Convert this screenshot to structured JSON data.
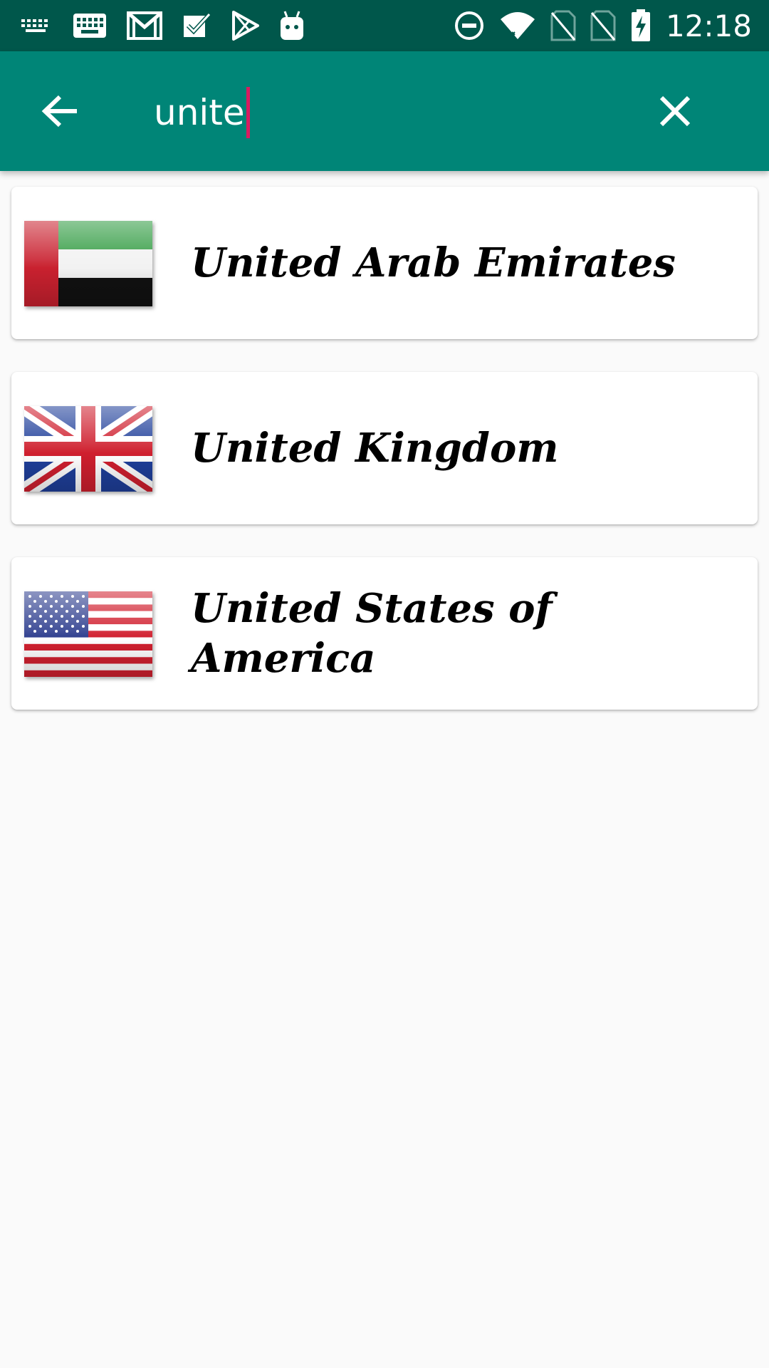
{
  "status_bar": {
    "time": "12:18",
    "left_icons": [
      "keyboard-icon",
      "keyboard-icon",
      "gmail-icon",
      "tasks-icon",
      "play-store-icon",
      "android-icon"
    ],
    "right_icons": [
      "do-not-disturb-icon",
      "wifi-icon",
      "no-sim-icon",
      "no-sim-icon",
      "battery-charging-icon"
    ]
  },
  "search": {
    "value": "unite",
    "back_icon": "arrow-back-icon",
    "clear_icon": "close-icon"
  },
  "results": [
    {
      "name": "United Arab Emirates",
      "flag": "uae-flag"
    },
    {
      "name": "United Kingdom",
      "flag": "uk-flag"
    },
    {
      "name": "United States of America",
      "flag": "usa-flag"
    }
  ],
  "colors": {
    "status_bar": "#00574b",
    "app_bar": "#008577",
    "caret": "#d81b60",
    "background": "#fafafa"
  }
}
